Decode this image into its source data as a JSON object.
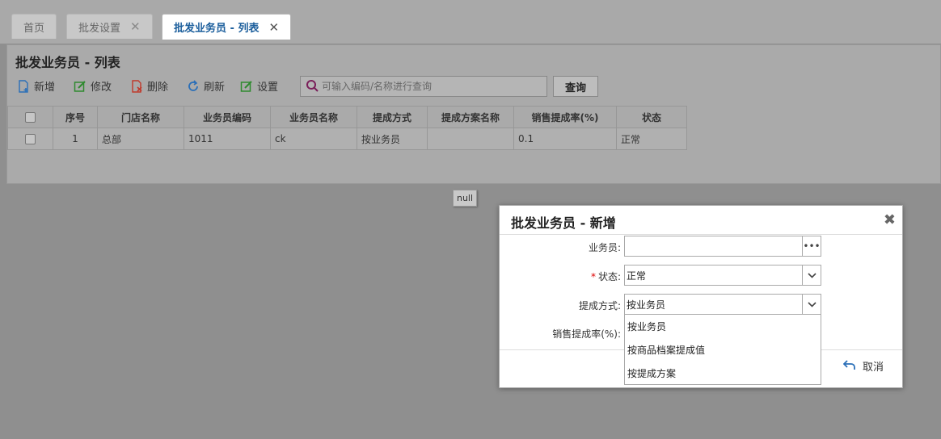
{
  "tabs": [
    {
      "label": "首页",
      "closable": false,
      "active": false
    },
    {
      "label": "批发设置",
      "closable": true,
      "active": false
    },
    {
      "label": "批发业务员 - 列表",
      "closable": true,
      "active": true
    }
  ],
  "panel": {
    "title": "批发业务员 - 列表",
    "toolbar": {
      "add": "新增",
      "edit": "修改",
      "delete": "删除",
      "refresh": "刷新",
      "settings": "设置"
    },
    "search": {
      "placeholder": "可输入编码/名称进行查询",
      "value": ""
    },
    "query_label": "查询"
  },
  "table": {
    "columns": [
      "序号",
      "门店名称",
      "业务员编码",
      "业务员名称",
      "提成方式",
      "提成方案名称",
      "销售提成率(%)",
      "状态"
    ],
    "rows": [
      {
        "index": "1",
        "store": "总部",
        "code": "1011",
        "name": "ck",
        "method": "按业务员",
        "plan": "",
        "rate": "0.1",
        "status": "正常"
      }
    ]
  },
  "tooltip": "null",
  "dialog": {
    "title": "批发业务员 - 新增",
    "fields": {
      "salesman_label": "业务员:",
      "salesman_value": "",
      "status_label": "状态:",
      "status_value": "正常",
      "method_label": "提成方式:",
      "method_value": "按业务员",
      "rate_label": "销售提成率(%):"
    },
    "dropdown_options": [
      "按业务员",
      "按商品档案提成值",
      "按提成方案"
    ],
    "cancel_label": "取消"
  },
  "colors": {
    "active_tab": "#1b5e9c",
    "link": "#2a4f7a",
    "required": "#d00000"
  }
}
